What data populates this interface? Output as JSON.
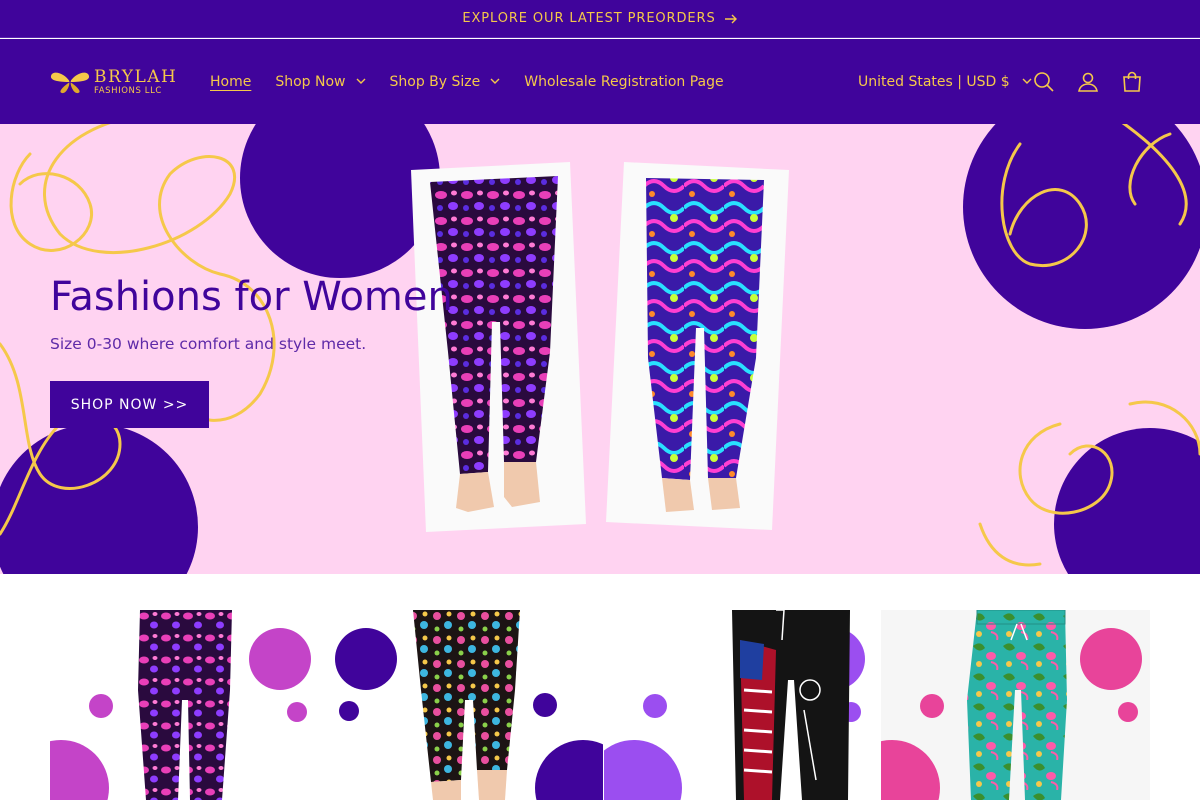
{
  "announcement": {
    "text": "EXPLORE OUR LATEST PREORDERS",
    "arrow_icon": "arrow-right-icon"
  },
  "header": {
    "logo": {
      "main": "BRYLAH",
      "sub": "FASHIONS LLC",
      "icon": "butterfly-icon"
    },
    "nav": [
      {
        "label": "Home",
        "active": true
      },
      {
        "label": "Shop Now",
        "dropdown": true
      },
      {
        "label": "Shop By Size",
        "dropdown": true
      },
      {
        "label": "Wholesale Registration Page"
      }
    ],
    "region": "United States | USD $",
    "icons": [
      "search-icon",
      "account-icon",
      "cart-icon"
    ]
  },
  "hero": {
    "title": "Fashions for Women",
    "subtitle": "Size 0-30 where comfort and style meet.",
    "button": "SHOP NOW >>"
  },
  "products": [
    {
      "name": "leopard-print-leggings",
      "accent": "#c444c8"
    },
    {
      "name": "floral-capri-leggings",
      "accent": "#40049b"
    },
    {
      "name": "we-the-people-joggers",
      "accent": "#9b4ef0"
    },
    {
      "name": "flamingo-print-pants",
      "accent": "#e8449a"
    }
  ],
  "colors": {
    "brand_purple": "#40049b",
    "accent_gold": "#f5c84a",
    "hero_pink": "#ffd3f1"
  }
}
